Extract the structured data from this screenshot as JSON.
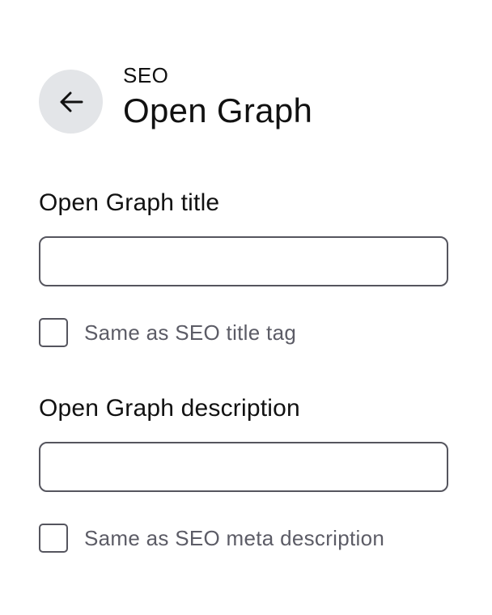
{
  "header": {
    "back_icon": "arrow-left-icon",
    "breadcrumb": "SEO",
    "title": "Open Graph"
  },
  "fields": {
    "og_title": {
      "label": "Open Graph title",
      "value": "",
      "placeholder": "",
      "checkbox_label": "Same as SEO title tag",
      "checked": false
    },
    "og_description": {
      "label": "Open Graph description",
      "value": "",
      "placeholder": "",
      "checkbox_label": "Same as SEO meta description",
      "checked": false
    }
  },
  "colors": {
    "back_button_bg": "#e3e5e8",
    "border": "#55555e",
    "muted_text": "#5c5c66"
  }
}
